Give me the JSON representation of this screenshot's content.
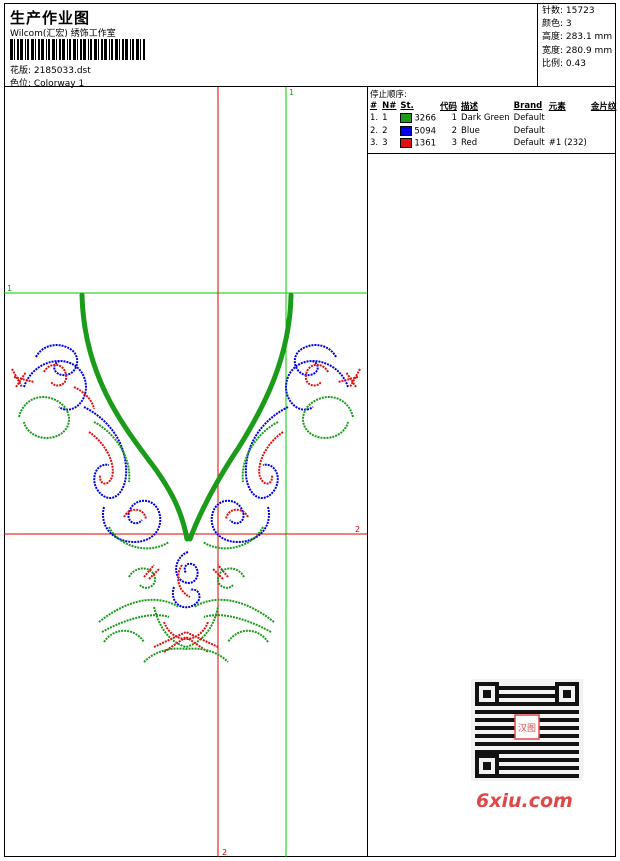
{
  "header": {
    "title": "生产作业图",
    "company": "Wilcom(汇宏) 绣饰工作室",
    "design_label": "花版: 2185033.dst",
    "colorway_label": "色位: Colorway 1"
  },
  "specs": [
    {
      "label": "针数:",
      "value": "15723"
    },
    {
      "label": "颜色:",
      "value": "3"
    },
    {
      "label": "高度:",
      "value": "283.1 mm"
    },
    {
      "label": "宽度:",
      "value": "280.9 mm"
    },
    {
      "label": "比例:",
      "value": "0.43"
    }
  ],
  "stop_sequence": {
    "title": "停止顺序:",
    "columns": [
      "#",
      "N#",
      "St.",
      "代码",
      "描述",
      "Brand",
      "元素",
      "金片纹"
    ],
    "rows": [
      {
        "index": "1.",
        "n": "1",
        "stitches": "3266",
        "code": "1",
        "desc": "Dark Green",
        "brand": "Default",
        "element": "",
        "sequin": "",
        "color": "#1a9b1a"
      },
      {
        "index": "2.",
        "n": "2",
        "stitches": "5094",
        "code": "2",
        "desc": "Blue",
        "brand": "Default",
        "element": "",
        "sequin": "",
        "color": "#0000e6"
      },
      {
        "index": "3.",
        "n": "3",
        "stitches": "1361",
        "code": "3",
        "desc": "Red",
        "brand": "Default",
        "element": "#1 (232)",
        "sequin": "",
        "color": "#e01010"
      }
    ]
  },
  "guides": {
    "vertical_top_label": "1",
    "horizontal_left_label": "1",
    "horizontal_right_label": "2",
    "vertical_bottom_label": "2"
  },
  "watermark": {
    "text": "6xiu.com",
    "stamp": "汉图"
  },
  "colors": {
    "green_guide": "#00cc00",
    "red_guide": "#e00000",
    "thread_green": "#1a9b1a",
    "thread_blue": "#0000e6",
    "thread_red": "#e01010"
  }
}
